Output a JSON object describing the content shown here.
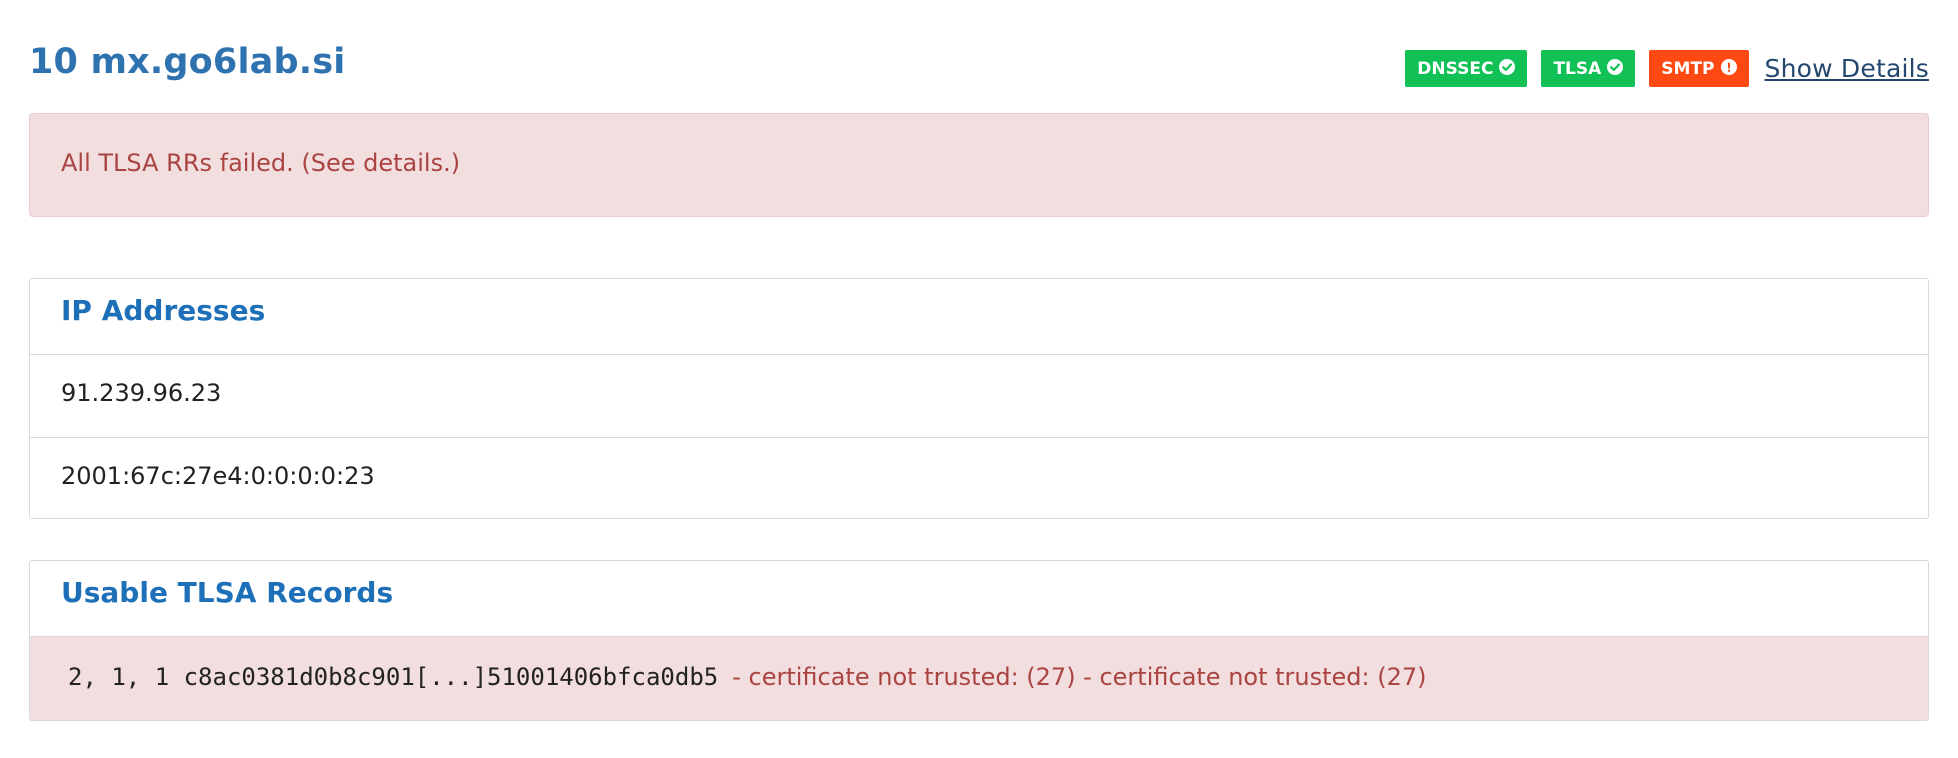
{
  "header": {
    "title": "10 mx.go6lab.si",
    "badges": [
      {
        "label": "DNSSEC",
        "icon": "check-circle-icon",
        "status": "ok",
        "color": "#12c155"
      },
      {
        "label": "TLSA",
        "icon": "check-circle-icon",
        "status": "ok",
        "color": "#12c155"
      },
      {
        "label": "SMTP",
        "icon": "exclamation-circle-icon",
        "status": "error",
        "color": "#ff4912"
      }
    ],
    "show_details_label": "Show Details"
  },
  "alert": {
    "text": "All TLSA RRs failed. (See details.)"
  },
  "ip_panel": {
    "heading": "IP Addresses",
    "rows": [
      "91.239.96.23",
      "2001:67c:27e4:0:0:0:0:23"
    ]
  },
  "tlsa_panel": {
    "heading": "Usable TLSA Records",
    "record": "2, 1, 1 c8ac0381d0b8c901[...]51001406bfca0db5",
    "errors": "- certificate not trusted: (27) - certificate not trusted: (27)"
  }
}
